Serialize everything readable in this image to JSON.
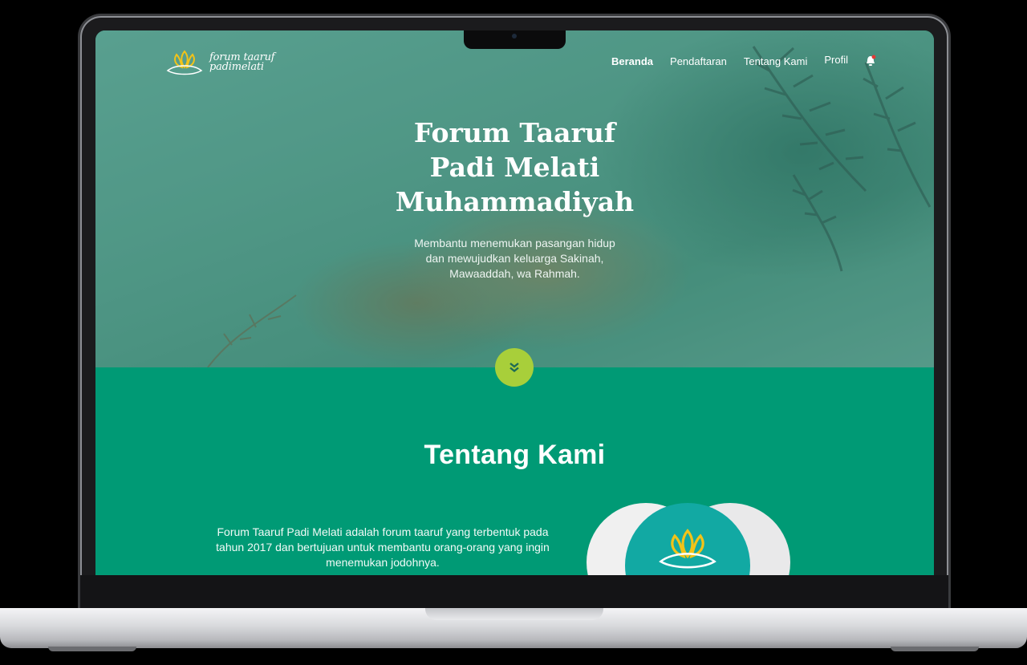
{
  "brand": {
    "line1": "forum taaruf",
    "line2": "padimelati"
  },
  "nav": {
    "items": [
      "Beranda",
      "Pendaftaran",
      "Tentang Kami",
      "Profil"
    ],
    "active": "Beranda"
  },
  "hero": {
    "title_lines": [
      "Forum Taaruf",
      "Padi Melati",
      "Muhammadiyah"
    ],
    "subtitle_lines": [
      "Membantu menemukan pasangan hidup",
      "dan mewujudkan keluarga Sakinah,",
      "Mawaaddah, wa Rahmah."
    ]
  },
  "about": {
    "title": "Tentang Kami",
    "text_lines": [
      "Forum Taaruf Padi Melati adalah forum taaruf yang terbentuk pada",
      "tahun 2017 dan bertujuan untuk membantu orang-orang yang ingin",
      "menemukan jodohnya."
    ]
  },
  "colors": {
    "primary_green": "#009a75",
    "accent_lime": "#a8cf3a",
    "teal": "#12a9a3",
    "logo_yellow": "#f2c318"
  },
  "icons": [
    "padi-melati-logo-icon",
    "bell-icon",
    "double-chevron-down-icon"
  ]
}
